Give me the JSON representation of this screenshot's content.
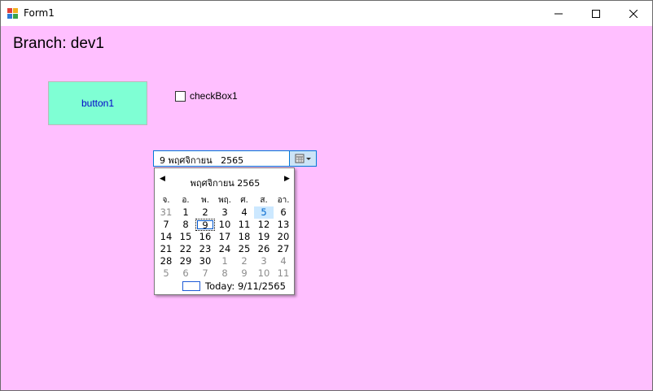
{
  "window": {
    "title": "Form1"
  },
  "form": {
    "branch_label": "Branch: dev1",
    "button1_label": "button1",
    "checkbox_label": "checkBox1",
    "checkbox_checked": false,
    "datepicker_value": "9 พฤศจิกายน   2565"
  },
  "calendar": {
    "month_title": "พฤศจิกายน 2565",
    "day_headers": [
      "จ.",
      "อ.",
      "พ.",
      "พฤ.",
      "ศ.",
      "ส.",
      "อา."
    ],
    "weeks": [
      [
        "31",
        "1",
        "2",
        "3",
        "4",
        "5",
        "6"
      ],
      [
        "7",
        "8",
        "9",
        "10",
        "11",
        "12",
        "13"
      ],
      [
        "14",
        "15",
        "16",
        "17",
        "18",
        "19",
        "20"
      ],
      [
        "21",
        "22",
        "23",
        "24",
        "25",
        "26",
        "27"
      ],
      [
        "28",
        "29",
        "30",
        "1",
        "2",
        "3",
        "4"
      ],
      [
        "5",
        "6",
        "7",
        "8",
        "9",
        "10",
        "11"
      ]
    ],
    "selected_day": "5",
    "today_day": "9",
    "today_label": "Today: 9/11/2565"
  },
  "colors": {
    "form_background": "#ffbfff",
    "button_background": "#7fffd4",
    "button_text": "#0000c8",
    "accent": "#0078d7"
  }
}
